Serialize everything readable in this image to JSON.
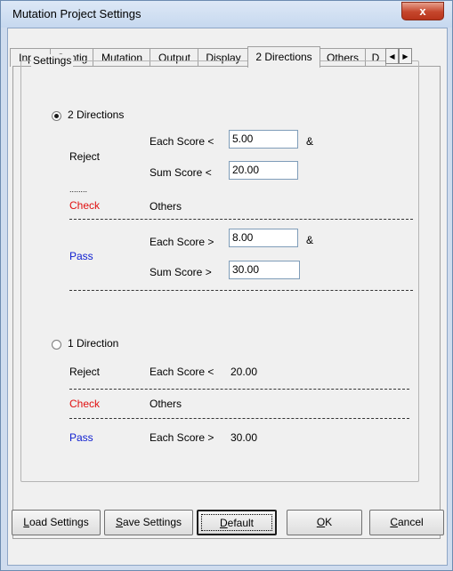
{
  "window": {
    "title": "Mutation Project Settings",
    "close_glyph": "x"
  },
  "tabs": [
    {
      "label": "Input"
    },
    {
      "label": "Contig"
    },
    {
      "label": "Mutation"
    },
    {
      "label": "Output"
    },
    {
      "label": "Display"
    },
    {
      "label": "2 Directions"
    },
    {
      "label": "Others"
    },
    {
      "label": "D"
    }
  ],
  "active_tab": "2 Directions",
  "tab_scroll": {
    "left_icon": "arrow-left-icon",
    "right_icon": "arrow-right-icon"
  },
  "settings": {
    "group_label": "Settings",
    "two_directions": {
      "label": "2 Directions",
      "selected": true,
      "reject_label": "Reject",
      "each_score_lt_label": "Each Score <",
      "each_score_lt_value": "5.00",
      "amp": "&",
      "sum_score_lt_label": "Sum Score <",
      "sum_score_lt_value": "20.00",
      "short_dashes": "........",
      "check_label": "Check",
      "others_label": "Others",
      "pass_label": "Pass",
      "each_score_gt_label": "Each Score >",
      "each_score_gt_value": "8.00",
      "sum_score_gt_label": "Sum Score >",
      "sum_score_gt_value": "30.00"
    },
    "one_direction": {
      "label": "1 Direction",
      "selected": false,
      "reject_label": "Reject",
      "each_score_lt_label": "Each Score <",
      "each_score_lt_value": "20.00",
      "check_label": "Check",
      "others_label": "Others",
      "pass_label": "Pass",
      "each_score_gt_label": "Each Score >",
      "each_score_gt_value": "30.00"
    }
  },
  "buttons": {
    "load_settings_first": "L",
    "load_settings_rest": "oad Settings",
    "save_settings_first": "S",
    "save_settings_rest": "ave Settings",
    "default_first": "D",
    "default_rest": "efault",
    "ok_first": "O",
    "ok_rest": "K",
    "cancel_first": "C",
    "cancel_rest": "ancel"
  },
  "colors": {
    "check": "#e01010",
    "pass": "#1020d0",
    "title_close": "#c5462c"
  }
}
